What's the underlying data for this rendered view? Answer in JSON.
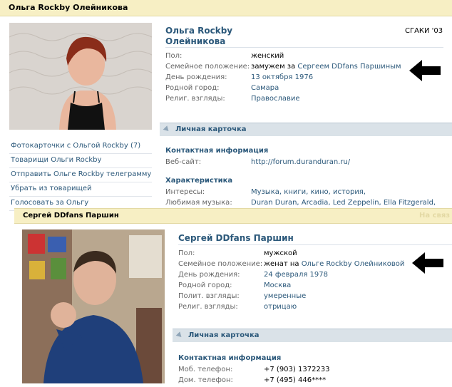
{
  "profile1": {
    "header_title": "Ольга Rockby Олейникова",
    "name_line1": "Ольга Rockby",
    "name_line2": "Олейникова",
    "school": "СГАКИ '03",
    "info": [
      {
        "label": "Пол:",
        "value": "женский",
        "link": false
      },
      {
        "label": "Семейное положение:",
        "value_prefix": "замужем за ",
        "value": "Сергеем DDfans Паршиным",
        "link": true
      },
      {
        "label": "День рождения:",
        "value": "13 октября 1976",
        "link": true
      },
      {
        "label": "Родной город:",
        "value": "Самара",
        "link": true
      },
      {
        "label": "Религ. взгляды:",
        "value": "Православие",
        "link": true
      }
    ],
    "links": [
      "Фотокарточки с Ольгой Rockby (7)",
      "Товарищи Ольги Rockby",
      "Отправить Ольге Rockby телеграмму",
      "Убрать из товарищей",
      "Голосовать за Ольгу"
    ],
    "section_title": "Личная карточка",
    "contact_head": "Контактная информация",
    "website_label": "Веб-сайт:",
    "website_value": "http://forum.duranduran.ru/",
    "char_head": "Характеристика",
    "interests_label": "Интересы:",
    "interests_value": "Музыка, книги, кино, история,",
    "music_label": "Любимая музыка:",
    "music_value": "Duran Duran, Arcadia, Led Zeppelin, Ella Fitzgerald,"
  },
  "profile2": {
    "header_title": "Сергей DDfans Паршин",
    "header_right": "На связ",
    "name": "Сергей DDfans Паршин",
    "info": [
      {
        "label": "Пол:",
        "value": "мужской",
        "link": false
      },
      {
        "label": "Семейное положение:",
        "value_prefix": "женат на ",
        "value": "Ольге Rockby Олейниковой",
        "link": true
      },
      {
        "label": "День рождения:",
        "value": "24 февраля 1978",
        "link": true
      },
      {
        "label": "Родной город:",
        "value": "Москва",
        "link": true
      },
      {
        "label": "Полит. взгляды:",
        "value": "умеренные",
        "link": true
      },
      {
        "label": "Религ. взгляды:",
        "value": "отрицаю",
        "link": true
      }
    ],
    "section_title": "Личная карточка",
    "contact_head": "Контактная информация",
    "mobile_label": "Моб. телефон:",
    "mobile_value": "+7 (903) 1372233",
    "home_label": "Дом. телефон:",
    "home_value": "+7 (495) 446****"
  },
  "colors": {
    "accent": "#2b587a",
    "header_bg": "#f7efc4",
    "section_bg": "#dae2e8"
  }
}
